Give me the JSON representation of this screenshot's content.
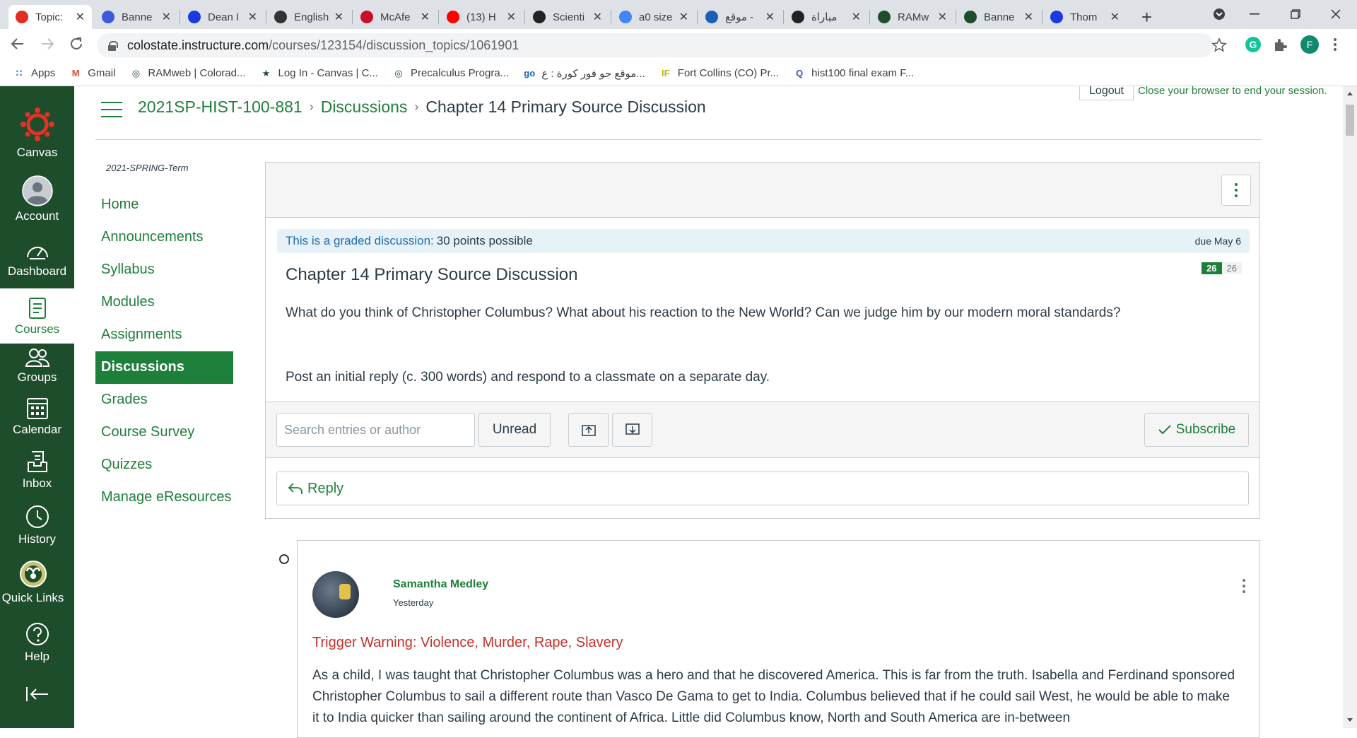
{
  "browser": {
    "tabs": [
      {
        "title": "Topic:",
        "active": true,
        "color": "#e32d22"
      },
      {
        "title": "Banne",
        "color": "#3b5bdb"
      },
      {
        "title": "Dean I",
        "color": "#1a3ae0"
      },
      {
        "title": "English",
        "color": "#333333"
      },
      {
        "title": "McAfe",
        "color": "#c8102e"
      },
      {
        "title": "(13) H",
        "color": "#ff0000"
      },
      {
        "title": "Scienti",
        "color": "#222222"
      },
      {
        "title": "a0 size",
        "color": "#4285f4"
      },
      {
        "title": "موقع -",
        "color": "#1a5fb4"
      },
      {
        "title": "مباراة",
        "color": "#222222"
      },
      {
        "title": "RAMw",
        "color": "#1e4d2b"
      },
      {
        "title": "Banne",
        "color": "#1e4d2b"
      },
      {
        "title": "Thom",
        "color": "#1a3ae0"
      }
    ],
    "new_tab": "+",
    "url_host": "colostate.instructure.com",
    "url_path": "/courses/123154/discussion_topics/1061901",
    "profile_initial": "F",
    "bookmarks": [
      {
        "label": "Apps",
        "icon": "apps-grid-icon"
      },
      {
        "label": "Gmail",
        "icon": "gmail-icon"
      },
      {
        "label": "RAMweb | Colorad...",
        "icon": "ram-icon"
      },
      {
        "label": "Log In - Canvas | C...",
        "icon": "csu-icon"
      },
      {
        "label": "Precalculus Progra...",
        "icon": "ram-icon"
      },
      {
        "label": "موقع جو فور كورة : ع...",
        "icon": "go-icon"
      },
      {
        "label": "Fort Collins (CO) Pr...",
        "icon": "if-icon"
      },
      {
        "label": "hist100 final exam F...",
        "icon": "quizlet-icon"
      }
    ]
  },
  "global_nav": {
    "items": [
      {
        "label": "Canvas",
        "icon": "canvas-logo-icon"
      },
      {
        "label": "Account",
        "icon": "account-icon"
      },
      {
        "label": "Dashboard",
        "icon": "dashboard-icon"
      },
      {
        "label": "Courses",
        "icon": "courses-icon",
        "active": true
      },
      {
        "label": "Groups",
        "icon": "groups-icon"
      },
      {
        "label": "Calendar",
        "icon": "calendar-icon"
      },
      {
        "label": "Inbox",
        "icon": "inbox-icon"
      },
      {
        "label": "History",
        "icon": "history-icon"
      },
      {
        "label": "Quick Links",
        "icon": "ram-logo-icon"
      },
      {
        "label": "Help",
        "icon": "help-icon"
      }
    ]
  },
  "breadcrumb": {
    "course": "2021SP-HIST-100-881",
    "section": "Discussions",
    "current": "Chapter 14 Primary Source Discussion"
  },
  "session": {
    "logout": "Logout",
    "close_msg": "Close your browser to end your session."
  },
  "course_nav": {
    "term": "2021-SPRING-Term",
    "items": [
      "Home",
      "Announcements",
      "Syllabus",
      "Modules",
      "Assignments",
      "Discussions",
      "Grades",
      "Course Survey",
      "Quizzes",
      "Manage eResources"
    ],
    "active": "Discussions"
  },
  "discussion": {
    "graded_label": "This is a graded discussion:",
    "points": "30 points possible",
    "due": "due May 6",
    "unread_count": "26",
    "total_count": "26",
    "title": "Chapter 14 Primary Source Discussion",
    "question": "What do you think of Christopher Columbus? What about his reaction to the New World?  Can we judge him by our modern moral standards?",
    "instructions": "Post an initial reply (c. 300 words) and respond to a classmate on a separate day.",
    "search_placeholder": "Search entries or author",
    "unread_button": "Unread",
    "subscribe_button": "Subscribe",
    "reply_label": "Reply"
  },
  "entry": {
    "author": "Samantha Medley",
    "time": "Yesterday",
    "warning": "Trigger Warning: Violence, Murder, Rape, Slavery",
    "text": "As a child, I was taught that Christopher Columbus was a hero and that he discovered America. This is far from the truth. Isabella and Ferdinand sponsored Christopher Columbus to sail a different route than Vasco De Gama to get to India. Columbus believed that if he could sail West, he would be able to make it to India quicker than sailing around the continent of Africa. Little did Columbus know, North and South America are in-between"
  },
  "colors": {
    "canvas_green": "#1e4d2b",
    "link_green": "#1e7f3b",
    "warning_red": "#c7302a",
    "graded_blue": "#1f6eb0"
  }
}
